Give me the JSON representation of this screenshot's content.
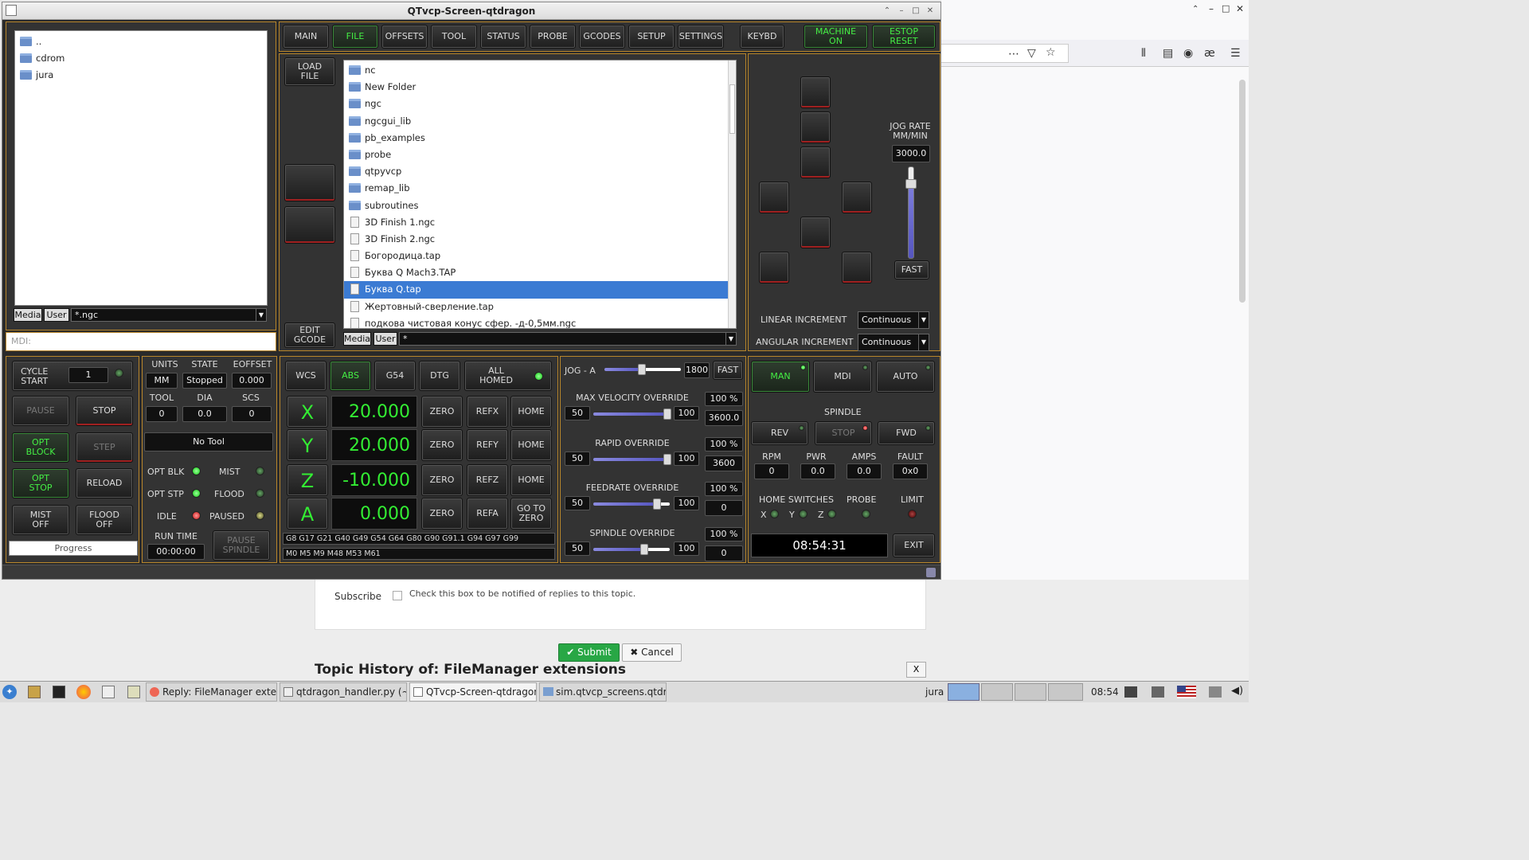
{
  "window_title": "QTvcp-Screen-qtdragon",
  "top_tabs": [
    "MAIN",
    "FILE",
    "OFFSETS",
    "TOOL",
    "STATUS",
    "PROBE",
    "GCODES",
    "SETUP",
    "SETTINGS"
  ],
  "keybd": "KEYBD",
  "machine_on": "MACHINE\nON",
  "estop_reset": "ESTOP\nRESET",
  "left_browser": {
    "items": [
      "..",
      "cdrom",
      "jura"
    ],
    "media": "Media",
    "user": "User",
    "filter": "*.ngc",
    "mdi_placeholder": "MDI:"
  },
  "file_panel": {
    "load_file": "LOAD\nFILE",
    "edit_gcode": "EDIT\nGCODE",
    "items": [
      {
        "name": "nc",
        "type": "folder"
      },
      {
        "name": "New Folder",
        "type": "folder"
      },
      {
        "name": "ngc",
        "type": "folder"
      },
      {
        "name": "ngcgui_lib",
        "type": "folder"
      },
      {
        "name": "pb_examples",
        "type": "folder"
      },
      {
        "name": "probe",
        "type": "folder"
      },
      {
        "name": "qtpyvcp",
        "type": "folder"
      },
      {
        "name": "remap_lib",
        "type": "folder"
      },
      {
        "name": "subroutines",
        "type": "folder"
      },
      {
        "name": "3D Finish 1.ngc",
        "type": "file"
      },
      {
        "name": "3D Finish 2.ngc",
        "type": "file"
      },
      {
        "name": "Богородица.tap",
        "type": "file"
      },
      {
        "name": "Буква Q Mach3.TAP",
        "type": "file"
      },
      {
        "name": "Буква Q.tap",
        "type": "file",
        "selected": true
      },
      {
        "name": "Жертовный-сверление.tap",
        "type": "file"
      },
      {
        "name": "подкова чистовая конус сфер. -д-0,5мм.ngc",
        "type": "file"
      }
    ],
    "media": "Media",
    "user": "User",
    "filter": "*"
  },
  "jog": {
    "jog_rate_label": "JOG RATE\nMM/MIN",
    "jog_rate_value": "3000.0",
    "fast": "FAST",
    "linear_increment_label": "LINEAR INCREMENT",
    "linear_increment_value": "Continuous",
    "angular_increment_label": "ANGULAR INCREMENT",
    "angular_increment_value": "Continuous"
  },
  "cycle": {
    "cycle_start": "CYCLE\nSTART",
    "cycle_count": "1",
    "pause": "PAUSE",
    "stop": "STOP",
    "opt_block": "OPT\nBLOCK",
    "step": "STEP",
    "opt_stop": "OPT\nSTOP",
    "reload": "RELOAD",
    "mist_off": "MIST\nOFF",
    "flood_off": "FLOOD\nOFF",
    "progress": "Progress"
  },
  "status": {
    "units_label": "UNITS",
    "units": "MM",
    "state_label": "STATE",
    "state": "Stopped",
    "eoffset_label": "EOFFSET",
    "eoffset": "0.000",
    "tool_label": "TOOL",
    "tool": "0",
    "dia_label": "DIA",
    "dia": "0.0",
    "scs_label": "SCS",
    "scs": "0",
    "tool_desc": "No Tool",
    "opt_blk": "OPT BLK",
    "mist": "MIST",
    "opt_stp": "OPT STP",
    "flood": "FLOOD",
    "idle": "IDLE",
    "paused": "PAUSED",
    "run_time_label": "RUN TIME",
    "run_time": "00:00:00",
    "pause_spindle": "PAUSE\nSPINDLE"
  },
  "dro": {
    "wcs": "WCS",
    "abs": "ABS",
    "g54": "G54",
    "dtg": "DTG",
    "all_homed": "ALL\nHOMED",
    "axes": [
      {
        "axis": "X",
        "value": "20.000",
        "ref": "REFX",
        "home": "HOME"
      },
      {
        "axis": "Y",
        "value": "20.000",
        "ref": "REFY",
        "home": "HOME"
      },
      {
        "axis": "Z",
        "value": "-10.000",
        "ref": "REFZ",
        "home": "HOME"
      },
      {
        "axis": "A",
        "value": "0.000",
        "ref": "REFA",
        "home": "GO TO\nZERO"
      }
    ],
    "zero": "ZERO",
    "gcodes": "G8 G17 G21 G40 G49 G54 G64 G80 G90 G91.1 G94 G97 G99",
    "mcodes": "M0 M5 M9 M48 M53 M61"
  },
  "overrides": {
    "jog_a_label": "JOG - A",
    "jog_a_value": "1800",
    "jog_a_fast": "FAST",
    "max_vel_label": "MAX VELOCITY OVERRIDE",
    "max_vel_pct": "100 %",
    "max_vel_val": "3600.0",
    "rapid_label": "RAPID OVERRIDE",
    "rapid_pct": "100 %",
    "rapid_val": "3600",
    "feed_label": "FEEDRATE OVERRIDE",
    "feed_pct": "100 %",
    "feed_val": "0",
    "spindle_label": "SPINDLE OVERRIDE",
    "spindle_pct": "100 %",
    "spindle_val": "0",
    "min": "50",
    "max": "100"
  },
  "mode": {
    "man": "MAN",
    "mdi": "MDI",
    "auto": "AUTO",
    "spindle_label": "SPINDLE",
    "rev": "REV",
    "stop": "STOP",
    "fwd": "FWD",
    "rpm_label": "RPM",
    "rpm": "0",
    "pwr_label": "PWR",
    "pwr": "0.0",
    "amps_label": "AMPS",
    "amps": "0.0",
    "fault_label": "FAULT",
    "fault": "0x0",
    "home_switches": "HOME SWITCHES",
    "probe": "PROBE",
    "limit": "LIMIT",
    "x": "X",
    "y": "Y",
    "z": "Z",
    "clock": "08:54:31",
    "exit": "EXIT"
  },
  "forum": {
    "subscribe": "Subscribe",
    "subscribe_text": "Check this box to be notified of replies to this topic.",
    "submit": "Submit",
    "cancel": "Cancel",
    "topic_history": "Topic History of: FileManager extensions",
    "close": "X"
  },
  "taskbar": {
    "items": [
      "Reply: FileManager exte...",
      "qtdragon_handler.py (~...",
      "QTvcp-Screen-qtdragon",
      "sim.qtvcp_screens.qtdr..."
    ],
    "user": "jura",
    "time": "08:54"
  }
}
